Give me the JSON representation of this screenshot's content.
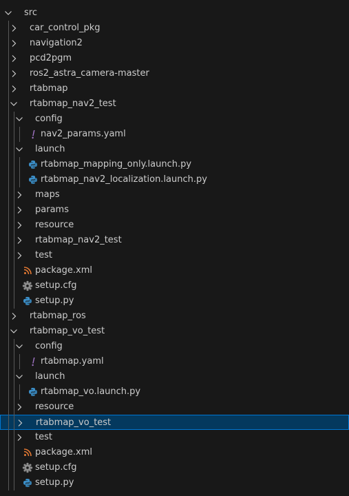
{
  "colors": {
    "background": "#181818",
    "text": "#cccccc",
    "selected_background": "#04395e",
    "selected_border": "#0078d4",
    "yaml_icon": "#a074c4",
    "python_icon": "#3b8fc9",
    "xml_icon": "#e37933",
    "cfg_icon": "#8c8c8c",
    "indent_guide": "#585858"
  },
  "tree": [
    {
      "label": "src",
      "depth": 0,
      "kind": "folder",
      "expanded": true
    },
    {
      "label": "car_control_pkg",
      "depth": 1,
      "kind": "folder",
      "expanded": false
    },
    {
      "label": "navigation2",
      "depth": 1,
      "kind": "folder",
      "expanded": false
    },
    {
      "label": "pcd2pgm",
      "depth": 1,
      "kind": "folder",
      "expanded": false
    },
    {
      "label": "ros2_astra_camera-master",
      "depth": 1,
      "kind": "folder",
      "expanded": false
    },
    {
      "label": "rtabmap",
      "depth": 1,
      "kind": "folder",
      "expanded": false
    },
    {
      "label": "rtabmap_nav2_test",
      "depth": 1,
      "kind": "folder",
      "expanded": true
    },
    {
      "label": "config",
      "depth": 2,
      "kind": "folder",
      "expanded": true
    },
    {
      "label": "nav2_params.yaml",
      "depth": 3,
      "kind": "yaml",
      "icon": "exclamation-icon"
    },
    {
      "label": "launch",
      "depth": 2,
      "kind": "folder",
      "expanded": true
    },
    {
      "label": "rtabmap_mapping_only.launch.py",
      "depth": 3,
      "kind": "python",
      "icon": "python-icon"
    },
    {
      "label": "rtabmap_nav2_localization.launch.py",
      "depth": 3,
      "kind": "python",
      "icon": "python-icon"
    },
    {
      "label": "maps",
      "depth": 2,
      "kind": "folder",
      "expanded": false
    },
    {
      "label": "params",
      "depth": 2,
      "kind": "folder",
      "expanded": false
    },
    {
      "label": "resource",
      "depth": 2,
      "kind": "folder",
      "expanded": false
    },
    {
      "label": "rtabmap_nav2_test",
      "depth": 2,
      "kind": "folder",
      "expanded": false
    },
    {
      "label": "test",
      "depth": 2,
      "kind": "folder",
      "expanded": false
    },
    {
      "label": "package.xml",
      "depth": 2,
      "kind": "xml",
      "icon": "rss-icon"
    },
    {
      "label": "setup.cfg",
      "depth": 2,
      "kind": "cfg",
      "icon": "gear-icon"
    },
    {
      "label": "setup.py",
      "depth": 2,
      "kind": "python",
      "icon": "python-icon"
    },
    {
      "label": "rtabmap_ros",
      "depth": 1,
      "kind": "folder",
      "expanded": false
    },
    {
      "label": "rtabmap_vo_test",
      "depth": 1,
      "kind": "folder",
      "expanded": true
    },
    {
      "label": "config",
      "depth": 2,
      "kind": "folder",
      "expanded": true
    },
    {
      "label": "rtabmap.yaml",
      "depth": 3,
      "kind": "yaml",
      "icon": "exclamation-icon"
    },
    {
      "label": "launch",
      "depth": 2,
      "kind": "folder",
      "expanded": true
    },
    {
      "label": "rtabmap_vo.launch.py",
      "depth": 3,
      "kind": "python",
      "icon": "python-icon"
    },
    {
      "label": "resource",
      "depth": 2,
      "kind": "folder",
      "expanded": false
    },
    {
      "label": "rtabmap_vo_test",
      "depth": 2,
      "kind": "folder",
      "expanded": false,
      "selected": true
    },
    {
      "label": "test",
      "depth": 2,
      "kind": "folder",
      "expanded": false
    },
    {
      "label": "package.xml",
      "depth": 2,
      "kind": "xml",
      "icon": "rss-icon"
    },
    {
      "label": "setup.cfg",
      "depth": 2,
      "kind": "cfg",
      "icon": "gear-icon"
    },
    {
      "label": "setup.py",
      "depth": 2,
      "kind": "python",
      "icon": "python-icon"
    }
  ]
}
